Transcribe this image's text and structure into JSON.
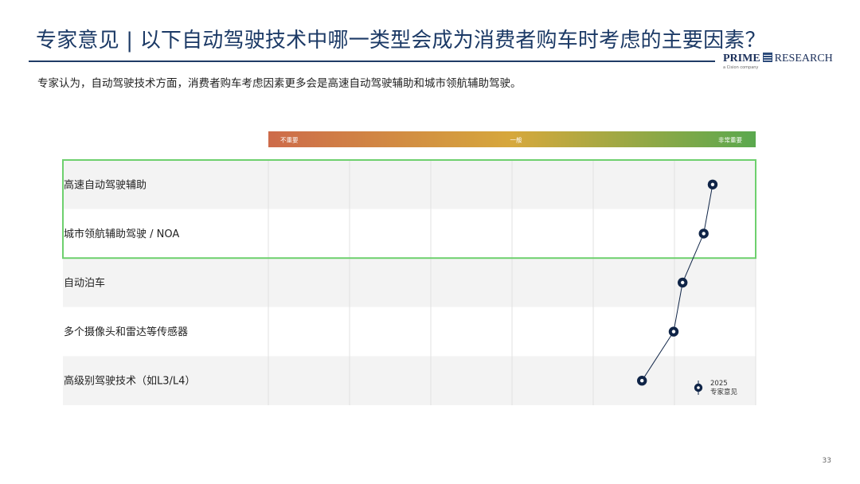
{
  "header": {
    "title": "专家意见 | 以下自动驾驶技术中哪一类型会成为消费者购车时考虑的主要因素？",
    "subtitle": "专家认为，自动驾驶技术方面，消费者购车考虑因素更多会是高速自动驾驶辅助和城市领航辅助驾驶。",
    "page_number": "33"
  },
  "logo": {
    "prime": "PRIME",
    "research": "RESEARCH",
    "tagline": "a Cision company"
  },
  "colors": {
    "scale_low": "#cd6b4a",
    "scale_mid": "#d6a83c",
    "scale_high": "#5aa84e",
    "highlight": "#6ed06e",
    "marker": "#0f2447",
    "row_alt": "#f3f3f3",
    "grid": "#e2e2e2"
  },
  "chart_data": {
    "type": "scatter",
    "scale_labels": [
      "不重要",
      "一般",
      "非常重要"
    ],
    "xlim": [
      0,
      6
    ],
    "categories": [
      "高速自动驾驶辅助",
      "城市领航辅助驾驶 / NOA",
      "自动泊车",
      "多个摄像头和雷达等传感器",
      "高级别驾驶技术（如L3/L4）"
    ],
    "series": [
      {
        "name": "2025 专家意见",
        "values": [
          5.47,
          5.36,
          5.1,
          4.99,
          4.6
        ]
      }
    ],
    "highlighted_rows": [
      0,
      1
    ],
    "legend": {
      "year": "2025",
      "label": "专家意见",
      "position": "bottom-right"
    }
  }
}
